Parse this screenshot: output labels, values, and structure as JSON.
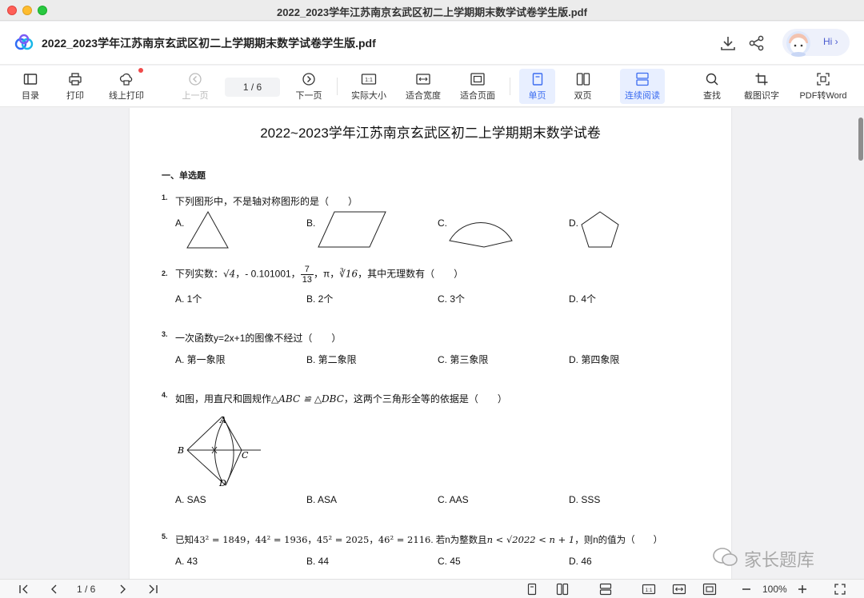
{
  "window": {
    "title": "2022_2023学年江苏南京玄武区初二上学期期末数学试卷学生版.pdf"
  },
  "header": {
    "doc_title": "2022_2023学年江苏南京玄武区初二上学期期末数学试卷学生版.pdf",
    "greeting": "Hi ›"
  },
  "toolbar": {
    "toc": "目录",
    "print": "打印",
    "online_print": "线上打印",
    "prev": "上一页",
    "page_indicator": "1 / 6",
    "next": "下一页",
    "actual_size": "实际大小",
    "fit_width": "适合宽度",
    "fit_page": "适合页面",
    "single": "单页",
    "double": "双页",
    "continuous": "连续阅读",
    "search": "查找",
    "ocr": "截图识字",
    "to_word": "PDF转Word",
    "one_to_one": "1:1"
  },
  "document": {
    "title": "2022~2023学年江苏南京玄武区初二上学期期末数学试卷",
    "section": "一、单选题",
    "questions": [
      {
        "num": "1.",
        "text": "下列图形中，不是轴对称图形的是（　　）",
        "options": [
          "A.",
          "B.",
          "C.",
          "D."
        ]
      },
      {
        "num": "2.",
        "text_a": "下列实数：",
        "text_b": "，- 0.101001，",
        "frac_num": "7",
        "frac_den": "13",
        "text_c": "，π，",
        "text_d": "，其中无理数有（　　）",
        "sqrt4": "√4",
        "cbrt16": "∛16",
        "options": [
          "A. 1个",
          "B. 2个",
          "C. 3个",
          "D. 4个"
        ]
      },
      {
        "num": "3.",
        "text": "一次函数y=2x+1的图像不经过（　　）",
        "options": [
          "A. 第一象限",
          "B. 第二象限",
          "C. 第三象限",
          "D. 第四象限"
        ]
      },
      {
        "num": "4.",
        "text_a": "如图，用直尺和圆规作",
        "tri": "△ABC ≌ △DBC",
        "text_b": "，这两个三角形全等的依据是（　　）",
        "labels": [
          "A",
          "B",
          "C",
          "D"
        ],
        "options": [
          "A. SAS",
          "B. ASA",
          "C. AAS",
          "D. SSS"
        ]
      },
      {
        "num": "5.",
        "text_a": "已知",
        "eqs": "43² = 1849，44² = 1936，45² = 2025，46² = 2116",
        "text_b": ". 若n为整数且",
        "ineq": "n < √2022 < n + 1",
        "text_c": "，则n的值为（　　）",
        "options": [
          "A. 43",
          "B. 44",
          "C. 45",
          "D. 46"
        ]
      }
    ]
  },
  "watermark": "家长题库",
  "statusbar": {
    "page_indicator": "1 / 6",
    "zoom": "100%",
    "one_to_one": "1:1"
  },
  "colors": {
    "accent": "#3b6cf0",
    "active_bg": "#e8efff",
    "badge": "#f04a4a"
  }
}
